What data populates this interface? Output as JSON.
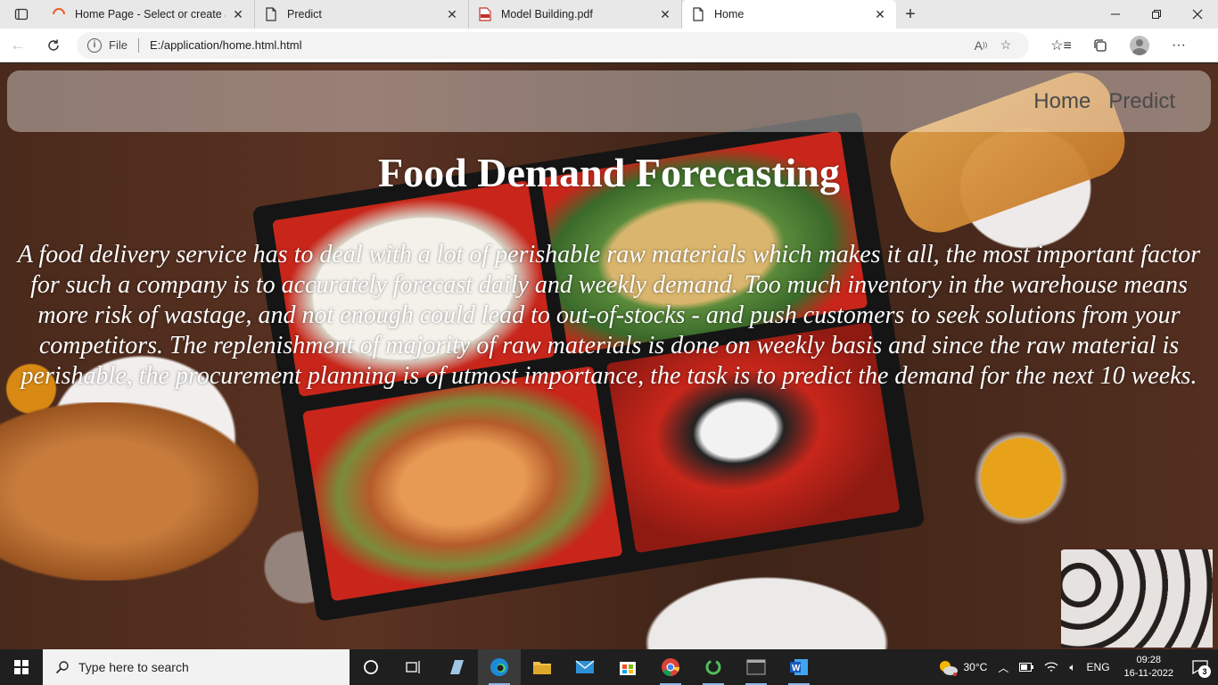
{
  "browser": {
    "tabs": [
      {
        "title": "Home Page - Select or create a n",
        "icon": "loading-spinner-icon",
        "active": false
      },
      {
        "title": "Predict",
        "icon": "page-icon",
        "active": false
      },
      {
        "title": "Model Building.pdf",
        "icon": "pdf-icon",
        "active": false
      },
      {
        "title": "Home",
        "icon": "page-icon",
        "active": true
      }
    ],
    "address": {
      "scheme_label": "File",
      "url": "E:/application/home.html.html"
    }
  },
  "page": {
    "nav": {
      "home": "Home",
      "predict": "Predict"
    },
    "title": "Food Demand Forecasting",
    "description": "A food delivery service has to deal with a lot of perishable raw materials which makes it all, the most important factor for such a company is to accurately forecast daily and weekly demand. Too much inventory in the warehouse means more risk of wastage, and not enough could lead to out-of-stocks - and push customers to seek solutions from your competitors. The replenishment of majority of raw materials is done on weekly basis and since the raw material is perishable, the procurement planning is of utmost importance, the task is to predict the demand for the next 10 weeks."
  },
  "taskbar": {
    "search_placeholder": "Type here to search",
    "weather": "30°C",
    "language": "ENG",
    "time": "09:28",
    "date": "16-11-2022",
    "notifications": "3"
  },
  "colors": {
    "nav_link": "#4a4a4a",
    "hero_text": "#ffffff",
    "taskbar": "#1f1f1f",
    "pdf_red": "#c4312a",
    "spinner_orange": "#e8622a"
  }
}
